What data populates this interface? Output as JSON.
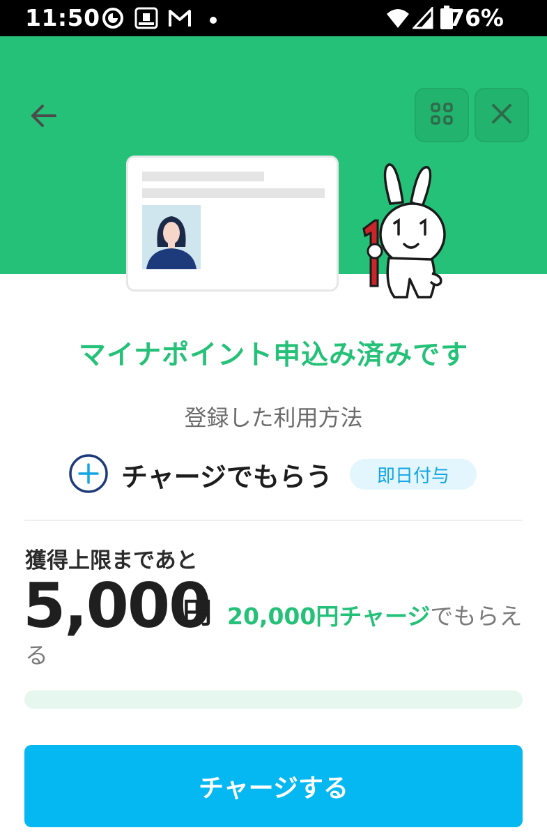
{
  "status_bar": {
    "time": "11:50",
    "battery": "76%",
    "icons": [
      "sync-icon",
      "station-icon",
      "gmail-icon",
      "dot-icon",
      "wifi-icon",
      "signal-icon",
      "battery-icon"
    ]
  },
  "header": {
    "background_color": "#25c178",
    "back_icon": "arrow-left-icon",
    "grid_icon": "grid-icon",
    "close_icon": "close-icon"
  },
  "main": {
    "headline": "マイナポイント申込み済みです",
    "method_label": "登録した利用方法",
    "method_name": "チャージでもらう",
    "method_badge": "即日付与",
    "limit_label": "獲得上限まであと",
    "amount": "5,000",
    "amount_unit": "円",
    "charge_amount": "20,000円チャージ",
    "charge_suffix": "でもらえる",
    "progress_fraction": 0.0
  },
  "button": {
    "label": "チャージする",
    "color": "#05b8f1"
  }
}
